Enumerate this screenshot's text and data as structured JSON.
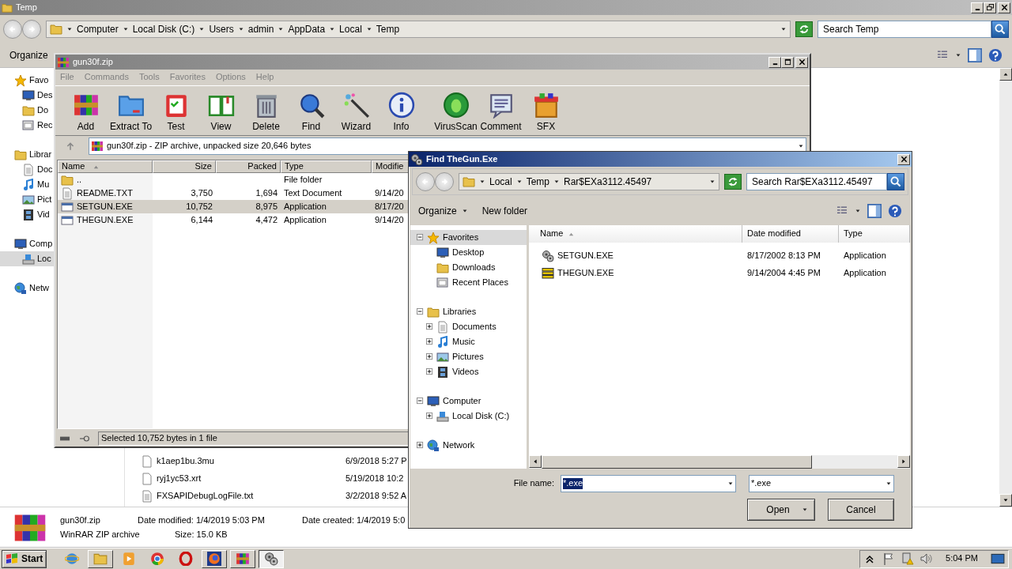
{
  "explorer": {
    "title": "Temp",
    "breadcrumbs": [
      "Computer",
      "Local Disk (C:)",
      "Users",
      "admin",
      "AppData",
      "Local",
      "Temp"
    ],
    "search": {
      "placeholder": "Search Temp"
    },
    "organize": "Organize",
    "sidebar": [
      {
        "label": "Favo",
        "selected": false,
        "children": [
          {
            "label": "Des",
            "selected": false
          },
          {
            "label": "Do",
            "selected": false
          },
          {
            "label": "Rec",
            "selected": false
          }
        ]
      },
      {
        "label": "Librar",
        "selected": false,
        "children": [
          {
            "label": "Doc",
            "selected": false
          },
          {
            "label": "Mu",
            "selected": false
          },
          {
            "label": "Pict",
            "selected": false
          },
          {
            "label": "Vid",
            "selected": false
          }
        ]
      },
      {
        "label": "Comp",
        "selected": false,
        "children": [
          {
            "label": "Loc",
            "selected": true
          }
        ]
      },
      {
        "label": "Netw",
        "selected": false
      }
    ],
    "files": [
      {
        "name": "k1aep1bu.3mu",
        "date": "6/9/2018 5:27 P",
        "kind": "blank"
      },
      {
        "name": "ryj1yc53.xrt",
        "date": "5/19/2018 10:2",
        "kind": "blank"
      },
      {
        "name": "FXSAPIDebugLogFile.txt",
        "date": "3/2/2018 9:52 A",
        "kind": "text"
      }
    ],
    "details": {
      "name": "gun30f.zip",
      "type": "WinRAR ZIP archive",
      "modified_label": "Date modified:",
      "modified": "1/4/2019 5:03 PM",
      "size_label": "Size:",
      "size": "15.0 KB",
      "created_label": "Date created:",
      "created": "1/4/2019 5:0"
    }
  },
  "winrar": {
    "title": "gun30f.zip",
    "menu": [
      {
        "label": "File",
        "disabled": true
      },
      {
        "label": "Commands",
        "disabled": true
      },
      {
        "label": "Tools",
        "disabled": true
      },
      {
        "label": "Favorites",
        "disabled": true
      },
      {
        "label": "Options",
        "disabled": true
      },
      {
        "label": "Help",
        "disabled": true
      }
    ],
    "tools": [
      "Add",
      "Extract To",
      "Test",
      "View",
      "Delete",
      "Find",
      "Wizard",
      "Info",
      "VirusScan",
      "Comment",
      "SFX"
    ],
    "path": "gun30f.zip - ZIP archive, unpacked size 20,646 bytes",
    "columns": [
      {
        "label": "Name",
        "sorted": true
      },
      {
        "label": "Size",
        "sorted": false
      },
      {
        "label": "Packed",
        "sorted": false
      },
      {
        "label": "Type",
        "sorted": false
      },
      {
        "label": "Modifie"
      }
    ],
    "rows": [
      {
        "kind": "folder",
        "name": "..",
        "type": "File folder",
        "selected": false
      },
      {
        "kind": "text",
        "name": "README.TXT",
        "size": "3,750",
        "packed": "1,694",
        "type": "Text Document",
        "modified": "9/14/20",
        "selected": false
      },
      {
        "kind": "application",
        "name": "SETGUN.EXE",
        "size": "10,752",
        "packed": "8,975",
        "type": "Application",
        "modified": "8/17/20",
        "selected": true
      },
      {
        "kind": "application",
        "name": "THEGUN.EXE",
        "size": "6,144",
        "packed": "4,472",
        "type": "Application",
        "modified": "9/14/20",
        "selected": false
      }
    ],
    "status": "Selected 10,752 bytes in 1 file"
  },
  "dialog": {
    "title": "Find TheGun.Exe",
    "breadcrumbs": [
      "Local",
      "Temp",
      "Rar$EXa3112.45497"
    ],
    "search": {
      "placeholder": "Search Rar$EXa3112.45497"
    },
    "organize": "Organize",
    "new_folder": "New folder",
    "tree": [
      {
        "label": "Favorites",
        "expanded": true,
        "selected": true,
        "children": [
          {
            "label": "Desktop",
            "selected": false
          },
          {
            "label": "Downloads",
            "selected": false
          },
          {
            "label": "Recent Places",
            "selected": false
          }
        ]
      },
      {
        "label": "Libraries",
        "expanded": true,
        "selected": false,
        "children": [
          {
            "label": "Documents",
            "expanded": false,
            "selected": false
          },
          {
            "label": "Music",
            "expanded": false,
            "selected": false
          },
          {
            "label": "Pictures",
            "expanded": false,
            "selected": false
          },
          {
            "label": "Videos",
            "expanded": false,
            "selected": false
          }
        ]
      },
      {
        "label": "Computer",
        "expanded": true,
        "selected": false,
        "children": [
          {
            "label": "Local Disk (C:)",
            "expanded": false,
            "selected": false
          }
        ]
      },
      {
        "label": "Network",
        "expanded": false,
        "selected": false
      }
    ],
    "columns": [
      {
        "label": "Name",
        "sorted": true
      },
      {
        "label": "Date modified",
        "sorted": false
      },
      {
        "label": "Type",
        "sorted": false
      }
    ],
    "files": [
      {
        "name": "SETGUN.EXE",
        "date": "8/17/2002 8:13 PM",
        "type": "Application"
      },
      {
        "name": "THEGUN.EXE",
        "date": "9/14/2004 4:45 PM",
        "type": "Application"
      }
    ],
    "file_name_label": "File name:",
    "file_name": {
      "value": "*.exe",
      "highlighted": true
    },
    "filter": "*.exe",
    "open": "Open",
    "cancel": "Cancel"
  },
  "taskbar": {
    "start": "Start",
    "buttons": [
      {
        "running": false,
        "selected": false
      },
      {
        "running": true,
        "selected": false
      },
      {
        "running": false,
        "selected": false
      },
      {
        "running": false,
        "selected": false
      },
      {
        "running": false,
        "selected": false
      },
      {
        "running": true,
        "selected": false
      },
      {
        "running": true,
        "selected": false
      },
      {
        "running": true,
        "selected": true
      }
    ],
    "clock": "5:04 PM"
  }
}
